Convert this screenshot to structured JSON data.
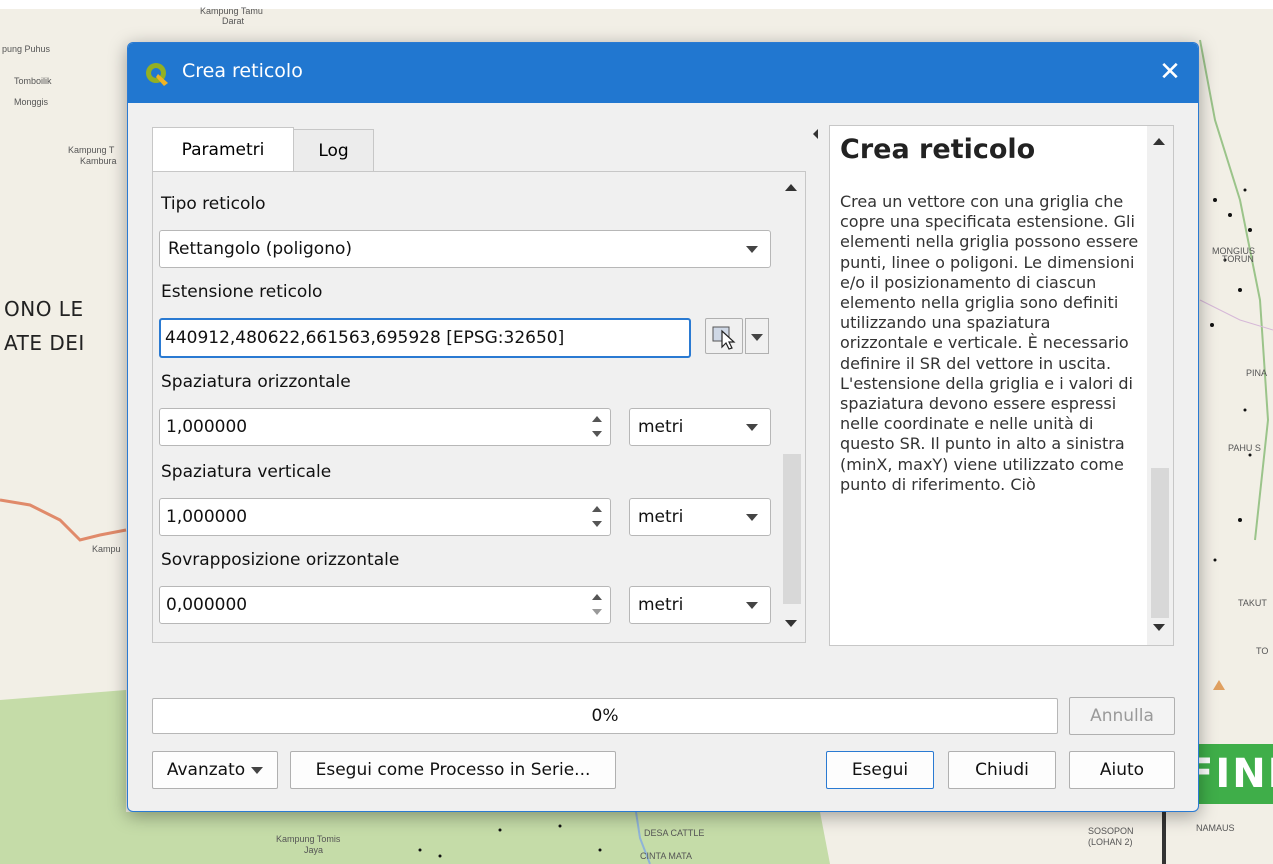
{
  "map": {
    "labels": {
      "kampung_tamu": "Kampung Tamu",
      "darat": "Darat",
      "pung_puhus": "pung Puhus",
      "tomboilik": "Tomboilik",
      "monggis": "Monggis",
      "kampung_t": "Kampung T",
      "kambura": "Kambura",
      "kampu": "Kampu",
      "kampung_tomis": "Kampung Tomis",
      "jaya": "Jaya",
      "desa_cattle": "DESA CATTLE",
      "cinta_mata": "CINTA MATA",
      "sosopon": "SOSOPON",
      "lohan": "(LOHAN 2)",
      "namaus": "NAMAUS",
      "mongius": "MONGIUS",
      "torun": "TORUN",
      "pina": "PINA",
      "pahu": "PAHU S",
      "takut": "TAKUT",
      "to": "TO"
    },
    "big_text_1": "ONO LE",
    "big_text_2": "ATE DEI",
    "fini": "FINI"
  },
  "dialog": {
    "title": "Crea reticolo",
    "close_glyph": "✕",
    "tabs": [
      {
        "label": "Parametri",
        "active": true
      },
      {
        "label": "Log",
        "active": false
      }
    ],
    "params": {
      "grid_type_label": "Tipo reticolo",
      "grid_type_value": "Rettangolo (poligono)",
      "extent_label": "Estensione reticolo",
      "extent_value": "440912,480622,661563,695928 [EPSG:32650]",
      "hspacing_label": "Spaziatura orizzontale",
      "hspacing_value": "1,000000",
      "hspacing_unit": "metri",
      "vspacing_label": "Spaziatura verticale",
      "vspacing_value": "1,000000",
      "vspacing_unit": "metri",
      "hoverlay_label": "Sovrapposizione orizzontale",
      "hoverlay_value": "0,000000",
      "hoverlay_unit": "metri"
    },
    "help": {
      "title": "Crea reticolo",
      "text": "Crea un vettore con una griglia che copre una specificata estensione. Gli elementi nella griglia possono essere punti, linee o poligoni. Le dimensioni e/o il posizionamento di ciascun elemento nella griglia sono definiti utilizzando una spaziatura orizzontale e verticale. È necessario definire il SR del vettore in uscita. L'estensione della griglia e i valori di spaziatura devono essere espressi nelle coordinate e nelle unità di questo SR. Il punto in alto a sinistra (minX, maxY) viene utilizzato come punto di riferimento. Ciò"
    },
    "progress": {
      "text": "0%",
      "value": 0
    },
    "buttons": {
      "cancel": "Annulla",
      "advanced": "Avanzato",
      "batch": "Esegui come Processo in Serie...",
      "run": "Esegui",
      "close": "Chiudi",
      "help": "Aiuto"
    }
  },
  "colors": {
    "titlebar": "#2177d0",
    "accent": "#2a7ad2",
    "fini": "#3fae49",
    "map_green": "#c5dca8",
    "map_bg": "#f2efe6"
  }
}
